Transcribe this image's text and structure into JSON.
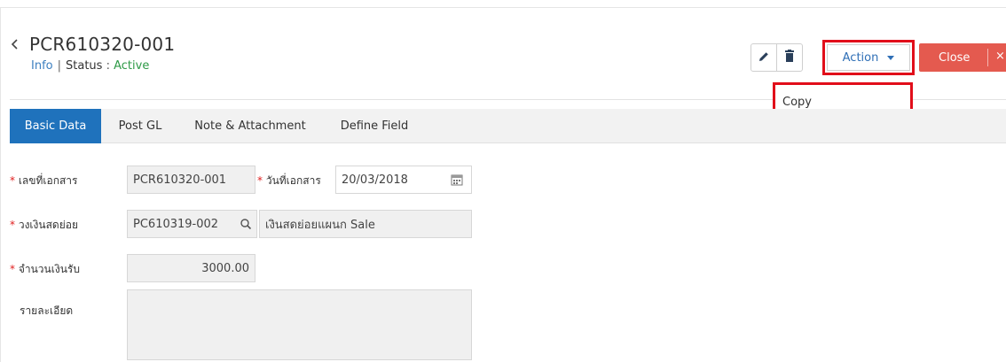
{
  "header": {
    "doc_no": "PCR610320-001",
    "info_link": "Info",
    "separator": "|",
    "status_label": "Status",
    "status_colon": ":",
    "status_value": "Active"
  },
  "toolbar": {
    "action_label": "Action",
    "close_label": "Close",
    "close_x": "×"
  },
  "action_menu": {
    "items": [
      {
        "label": "Copy"
      }
    ]
  },
  "tabs": [
    {
      "label": "Basic Data",
      "active": true
    },
    {
      "label": "Post GL",
      "active": false
    },
    {
      "label": "Note & Attachment",
      "active": false
    },
    {
      "label": "Define Field",
      "active": false
    }
  ],
  "form": {
    "required_mark": "*",
    "doc_no": {
      "label": "เลขที่เอกสาร",
      "value": "PCR610320-001"
    },
    "doc_date": {
      "label": "วันที่เอกสาร",
      "value": "20/03/2018"
    },
    "petty_cash": {
      "label": "วงเงินสดย่อย",
      "code": "PC610319-002",
      "name": "เงินสดย่อยแผนก Sale"
    },
    "amount": {
      "label": "จำนวนเงินรับ",
      "value": "3000.00"
    },
    "remark": {
      "label": "รายละเอียด",
      "value": ""
    }
  },
  "colors": {
    "accent": "#1f72bc",
    "status_active": "#2e9a47",
    "close_button": "#e45a4f",
    "highlight": "#e10e1a"
  }
}
